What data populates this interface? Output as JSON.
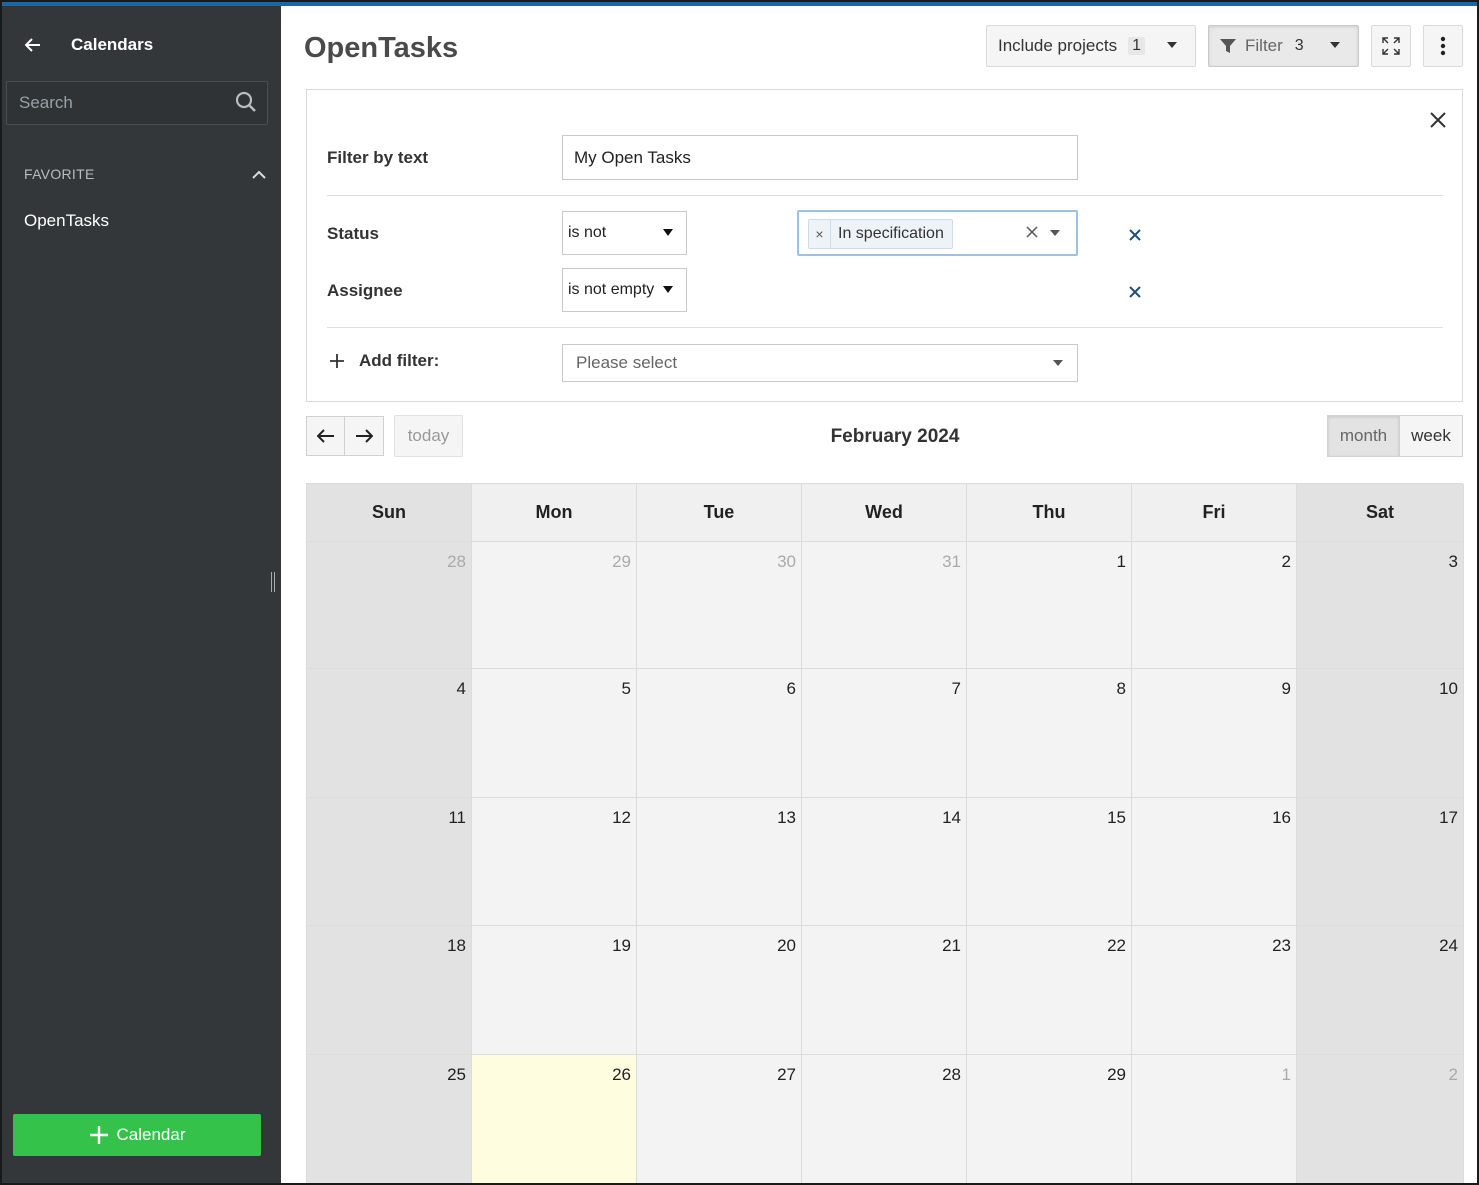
{
  "sidebar": {
    "title": "Calendars",
    "search_placeholder": "Search",
    "section_label": "FAVORITE",
    "items": [
      {
        "label": "OpenTasks"
      }
    ],
    "add_button_label": "Calendar"
  },
  "header": {
    "title": "OpenTasks",
    "include_projects_label": "Include projects",
    "include_projects_count": "1",
    "filter_label": "Filter",
    "filter_count": "3"
  },
  "filters": {
    "text_label": "Filter by text",
    "text_value": "My Open Tasks",
    "status_label": "Status",
    "status_operator": "is not",
    "status_values": [
      "In specification"
    ],
    "assignee_label": "Assignee",
    "assignee_operator": "is not empty",
    "add_filter_label": "Add filter:",
    "add_filter_placeholder": "Please select"
  },
  "calendar": {
    "today_label": "today",
    "title": "February 2024",
    "views": [
      "month",
      "week"
    ],
    "active_view": "month",
    "weekdays": [
      "Sun",
      "Mon",
      "Tue",
      "Wed",
      "Thu",
      "Fri",
      "Sat"
    ],
    "weeks": [
      [
        "28",
        "29",
        "30",
        "31",
        "1",
        "2",
        "3"
      ],
      [
        "4",
        "5",
        "6",
        "7",
        "8",
        "9",
        "10"
      ],
      [
        "11",
        "12",
        "13",
        "14",
        "15",
        "16",
        "17"
      ],
      [
        "18",
        "19",
        "20",
        "21",
        "22",
        "23",
        "24"
      ],
      [
        "25",
        "26",
        "27",
        "28",
        "29",
        "1",
        "2"
      ]
    ],
    "today_date": "26"
  },
  "colors": {
    "sidebar_bg": "#333739",
    "accent_green": "#35c24a",
    "top_bar": "#1a67a3",
    "today_bg": "#fefde0",
    "weekend_bg": "#e2e2e2"
  }
}
